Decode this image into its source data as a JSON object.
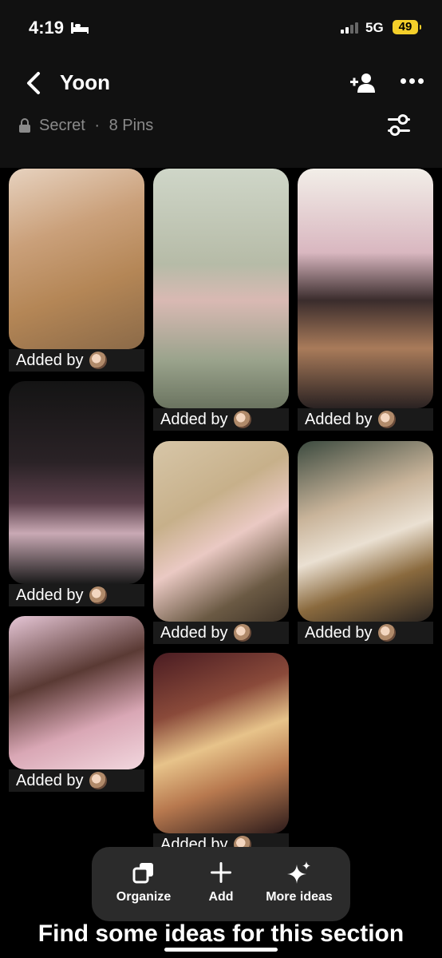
{
  "status": {
    "time": "4:19",
    "network": "5G",
    "battery": "49"
  },
  "header": {
    "title": "Yoon",
    "privacy": "Secret",
    "separator": "·",
    "pin_count": "8 Pins"
  },
  "pins": [
    {
      "caption": "Added by"
    },
    {
      "caption": "Added by"
    },
    {
      "caption": "Added by"
    },
    {
      "caption": "Added by"
    },
    {
      "caption": "Added by"
    },
    {
      "caption": "Added by"
    },
    {
      "caption": "Added by"
    },
    {
      "caption": "Added by"
    }
  ],
  "toolbar": {
    "organize": "Organize",
    "add": "Add",
    "more_ideas": "More ideas"
  },
  "footer": {
    "text": "Find some ideas for this section"
  }
}
